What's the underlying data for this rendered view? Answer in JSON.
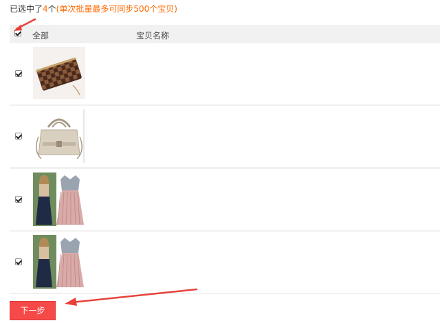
{
  "summary": {
    "prefix": "已选中了",
    "count": "4",
    "unit": "个",
    "note": "(单次批量最多可同步500个宝贝)"
  },
  "table": {
    "header": {
      "select_all_label": "全部",
      "name_label": "宝贝名称"
    },
    "rows": [
      {
        "checked": true,
        "image": "checkered-wallet"
      },
      {
        "checked": true,
        "image": "beige-handbag"
      },
      {
        "checked": true,
        "image": "pleated-dress-outfit"
      },
      {
        "checked": true,
        "image": "pleated-dress-outfit"
      }
    ]
  },
  "next_button": {
    "label": "下一步"
  },
  "colors": {
    "accent": "#ff6a00",
    "button": "#f64a49",
    "arrow": "#e8413b"
  }
}
